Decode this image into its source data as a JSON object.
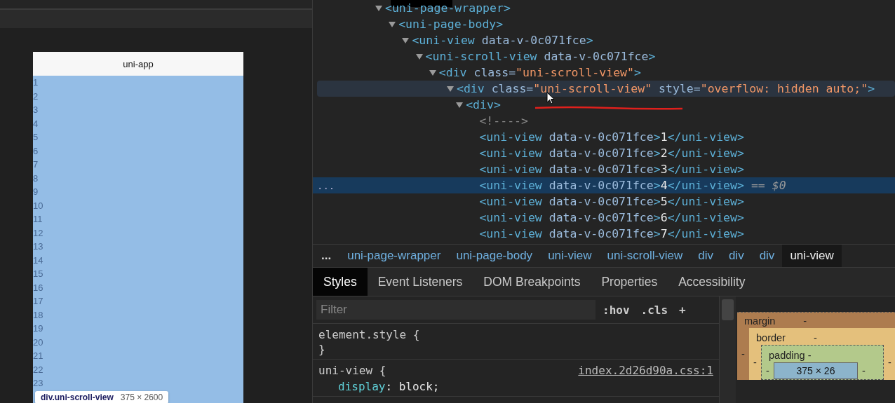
{
  "preview": {
    "title": "uni-app",
    "items": [
      "1",
      "2",
      "3",
      "4",
      "5",
      "6",
      "7",
      "8",
      "9",
      "10",
      "11",
      "12",
      "13",
      "14",
      "15",
      "16",
      "17",
      "18",
      "19",
      "20",
      "21",
      "22",
      "23"
    ],
    "tooltip": {
      "selector": "div.uni-scroll-view",
      "size": "375 × 2600"
    }
  },
  "dom_tree": {
    "gutter": "...",
    "selected_marker": "== $0",
    "nodes": [
      {
        "expanded": true,
        "selected": false,
        "hovered": false,
        "parts": [
          {
            "kind": "tag",
            "text": "<uni-page-wrapper>"
          }
        ],
        "children": [
          {
            "expanded": true,
            "selected": false,
            "hovered": false,
            "parts": [
              {
                "kind": "tag",
                "text": "<uni-page-body>"
              }
            ],
            "children": [
              {
                "expanded": true,
                "selected": false,
                "hovered": false,
                "parts": [
                  {
                    "kind": "tag",
                    "text": "<uni-view"
                  },
                  {
                    "kind": "attr",
                    "text": " data-v-0c071fce"
                  },
                  {
                    "kind": "tag",
                    "text": ">"
                  }
                ],
                "children": [
                  {
                    "expanded": true,
                    "selected": false,
                    "hovered": false,
                    "parts": [
                      {
                        "kind": "tag",
                        "text": "<uni-scroll-view"
                      },
                      {
                        "kind": "attr",
                        "text": " data-v-0c071fce"
                      },
                      {
                        "kind": "tag",
                        "text": ">"
                      }
                    ],
                    "children": [
                      {
                        "expanded": true,
                        "selected": false,
                        "hovered": false,
                        "parts": [
                          {
                            "kind": "tag",
                            "text": "<div"
                          },
                          {
                            "kind": "attr",
                            "text": " class="
                          },
                          {
                            "kind": "value",
                            "text": "\"uni-scroll-view\""
                          },
                          {
                            "kind": "tag",
                            "text": ">"
                          }
                        ],
                        "children": [
                          {
                            "expanded": true,
                            "selected": false,
                            "hovered": true,
                            "parts": [
                              {
                                "kind": "tag",
                                "text": "<div"
                              },
                              {
                                "kind": "attr",
                                "text": " class="
                              },
                              {
                                "kind": "value",
                                "text": "\"uni-scroll-view\""
                              },
                              {
                                "kind": "attr",
                                "text": " style="
                              },
                              {
                                "kind": "value",
                                "text": "\"overflow: hidden auto;\""
                              },
                              {
                                "kind": "tag",
                                "text": ">"
                              }
                            ],
                            "children": [
                              {
                                "expanded": true,
                                "selected": false,
                                "hovered": false,
                                "parts": [
                                  {
                                    "kind": "tag",
                                    "text": "<div>"
                                  }
                                ],
                                "children": [
                                  {
                                    "selected": false,
                                    "hovered": false,
                                    "parts": [
                                      {
                                        "kind": "comment",
                                        "text": "<!---->"
                                      }
                                    ]
                                  },
                                  {
                                    "selected": false,
                                    "hovered": false,
                                    "parts": [
                                      {
                                        "kind": "tag",
                                        "text": "<uni-view"
                                      },
                                      {
                                        "kind": "attr",
                                        "text": " data-v-0c071fce"
                                      },
                                      {
                                        "kind": "tag",
                                        "text": ">"
                                      },
                                      {
                                        "kind": "text",
                                        "text": "1"
                                      },
                                      {
                                        "kind": "tag",
                                        "text": "</uni-view>"
                                      }
                                    ]
                                  },
                                  {
                                    "selected": false,
                                    "hovered": false,
                                    "parts": [
                                      {
                                        "kind": "tag",
                                        "text": "<uni-view"
                                      },
                                      {
                                        "kind": "attr",
                                        "text": " data-v-0c071fce"
                                      },
                                      {
                                        "kind": "tag",
                                        "text": ">"
                                      },
                                      {
                                        "kind": "text",
                                        "text": "2"
                                      },
                                      {
                                        "kind": "tag",
                                        "text": "</uni-view>"
                                      }
                                    ]
                                  },
                                  {
                                    "selected": false,
                                    "hovered": false,
                                    "parts": [
                                      {
                                        "kind": "tag",
                                        "text": "<uni-view"
                                      },
                                      {
                                        "kind": "attr",
                                        "text": " data-v-0c071fce"
                                      },
                                      {
                                        "kind": "tag",
                                        "text": ">"
                                      },
                                      {
                                        "kind": "text",
                                        "text": "3"
                                      },
                                      {
                                        "kind": "tag",
                                        "text": "</uni-view>"
                                      }
                                    ]
                                  },
                                  {
                                    "selected": true,
                                    "hovered": false,
                                    "parts": [
                                      {
                                        "kind": "tag",
                                        "text": "<uni-view"
                                      },
                                      {
                                        "kind": "attr",
                                        "text": " data-v-0c071fce"
                                      },
                                      {
                                        "kind": "tag",
                                        "text": ">"
                                      },
                                      {
                                        "kind": "text",
                                        "text": "4"
                                      },
                                      {
                                        "kind": "tag",
                                        "text": "</uni-view>"
                                      }
                                    ]
                                  },
                                  {
                                    "selected": false,
                                    "hovered": false,
                                    "parts": [
                                      {
                                        "kind": "tag",
                                        "text": "<uni-view"
                                      },
                                      {
                                        "kind": "attr",
                                        "text": " data-v-0c071fce"
                                      },
                                      {
                                        "kind": "tag",
                                        "text": ">"
                                      },
                                      {
                                        "kind": "text",
                                        "text": "5"
                                      },
                                      {
                                        "kind": "tag",
                                        "text": "</uni-view>"
                                      }
                                    ]
                                  },
                                  {
                                    "selected": false,
                                    "hovered": false,
                                    "parts": [
                                      {
                                        "kind": "tag",
                                        "text": "<uni-view"
                                      },
                                      {
                                        "kind": "attr",
                                        "text": " data-v-0c071fce"
                                      },
                                      {
                                        "kind": "tag",
                                        "text": ">"
                                      },
                                      {
                                        "kind": "text",
                                        "text": "6"
                                      },
                                      {
                                        "kind": "tag",
                                        "text": "</uni-view>"
                                      }
                                    ]
                                  },
                                  {
                                    "selected": false,
                                    "hovered": false,
                                    "parts": [
                                      {
                                        "kind": "tag",
                                        "text": "<uni-view"
                                      },
                                      {
                                        "kind": "attr",
                                        "text": " data-v-0c071fce"
                                      },
                                      {
                                        "kind": "tag",
                                        "text": ">"
                                      },
                                      {
                                        "kind": "text",
                                        "text": "7"
                                      },
                                      {
                                        "kind": "tag",
                                        "text": "</uni-view>"
                                      }
                                    ]
                                  }
                                ]
                              }
                            ]
                          }
                        ]
                      }
                    ]
                  }
                ]
              }
            ]
          }
        ]
      }
    ]
  },
  "breadcrumbs": {
    "overflow": "...",
    "items": [
      {
        "label": "uni-page-wrapper",
        "selected": false
      },
      {
        "label": "uni-page-body",
        "selected": false
      },
      {
        "label": "uni-view",
        "selected": false
      },
      {
        "label": "uni-scroll-view",
        "selected": false
      },
      {
        "label": "div",
        "selected": false
      },
      {
        "label": "div",
        "selected": false
      },
      {
        "label": "div",
        "selected": false
      },
      {
        "label": "uni-view",
        "selected": true
      }
    ]
  },
  "tabs": [
    {
      "label": "Styles",
      "selected": true
    },
    {
      "label": "Event Listeners",
      "selected": false
    },
    {
      "label": "DOM Breakpoints",
      "selected": false
    },
    {
      "label": "Properties",
      "selected": false
    },
    {
      "label": "Accessibility",
      "selected": false
    }
  ],
  "filter": {
    "placeholder": "Filter",
    "buttons": [
      ":hov",
      ".cls",
      "+"
    ]
  },
  "rules": [
    {
      "selector": "element.style {",
      "close": "}"
    },
    {
      "selector": "uni-view {",
      "source": "index.2d26d90a.css:1",
      "declarations": [
        {
          "property": "display",
          "rest": ": block;"
        }
      ]
    }
  ],
  "box_model": {
    "layers": [
      {
        "kind": "margin",
        "label": "margin",
        "top": "-",
        "left": "-"
      },
      {
        "kind": "border",
        "label": "border",
        "top": "-",
        "left": "-",
        "right": "-"
      },
      {
        "kind": "padding",
        "label": "padding",
        "top": "-",
        "left": "-",
        "right": "-"
      }
    ],
    "content": "375 × 26"
  }
}
